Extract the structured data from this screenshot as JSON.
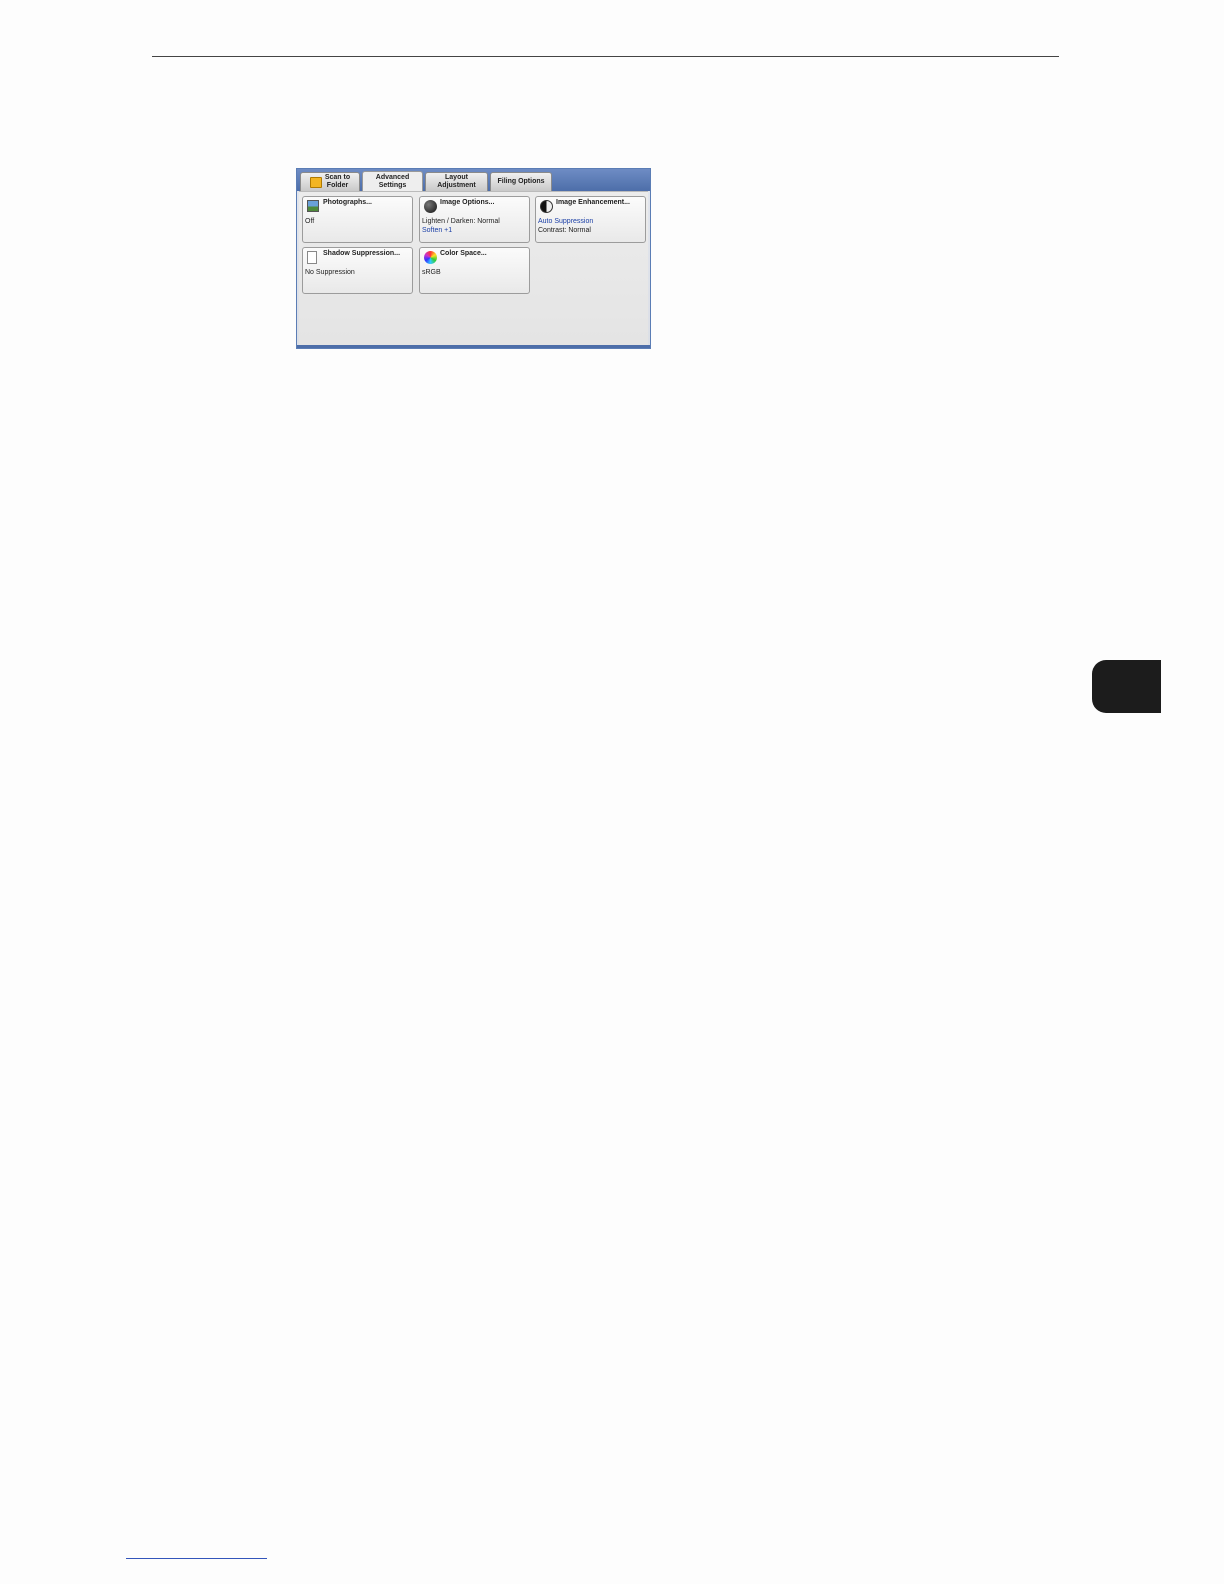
{
  "tabs": [
    {
      "label": "Scan to\nFolder",
      "icon": "folder-icon"
    },
    {
      "label": "Advanced\nSettings",
      "active": true
    },
    {
      "label": "Layout\nAdjustment"
    },
    {
      "label": "Filing Options"
    }
  ],
  "tiles": {
    "photographs": {
      "title": "Photographs...",
      "line1": "Off",
      "icon": "photo-icon"
    },
    "image_options": {
      "title": "Image Options...",
      "line1": "Lighten / Darken: Normal",
      "line2": "Soften +1",
      "icon": "circle-icon"
    },
    "image_enhancement": {
      "title": "Image Enhancement...",
      "line1": "Auto Suppression",
      "line2": "Contrast: Normal",
      "icon": "half-circle-icon"
    },
    "shadow_suppression": {
      "title": "Shadow Suppression...",
      "line1": "No Suppression",
      "icon": "document-icon"
    },
    "color_space": {
      "title": "Color Space...",
      "line1": "sRGB",
      "icon": "color-wheel-icon"
    }
  },
  "colors": {
    "accent": "#4d6ea9",
    "value_blue": "#1b3fa6",
    "folder": "#f3b521"
  }
}
